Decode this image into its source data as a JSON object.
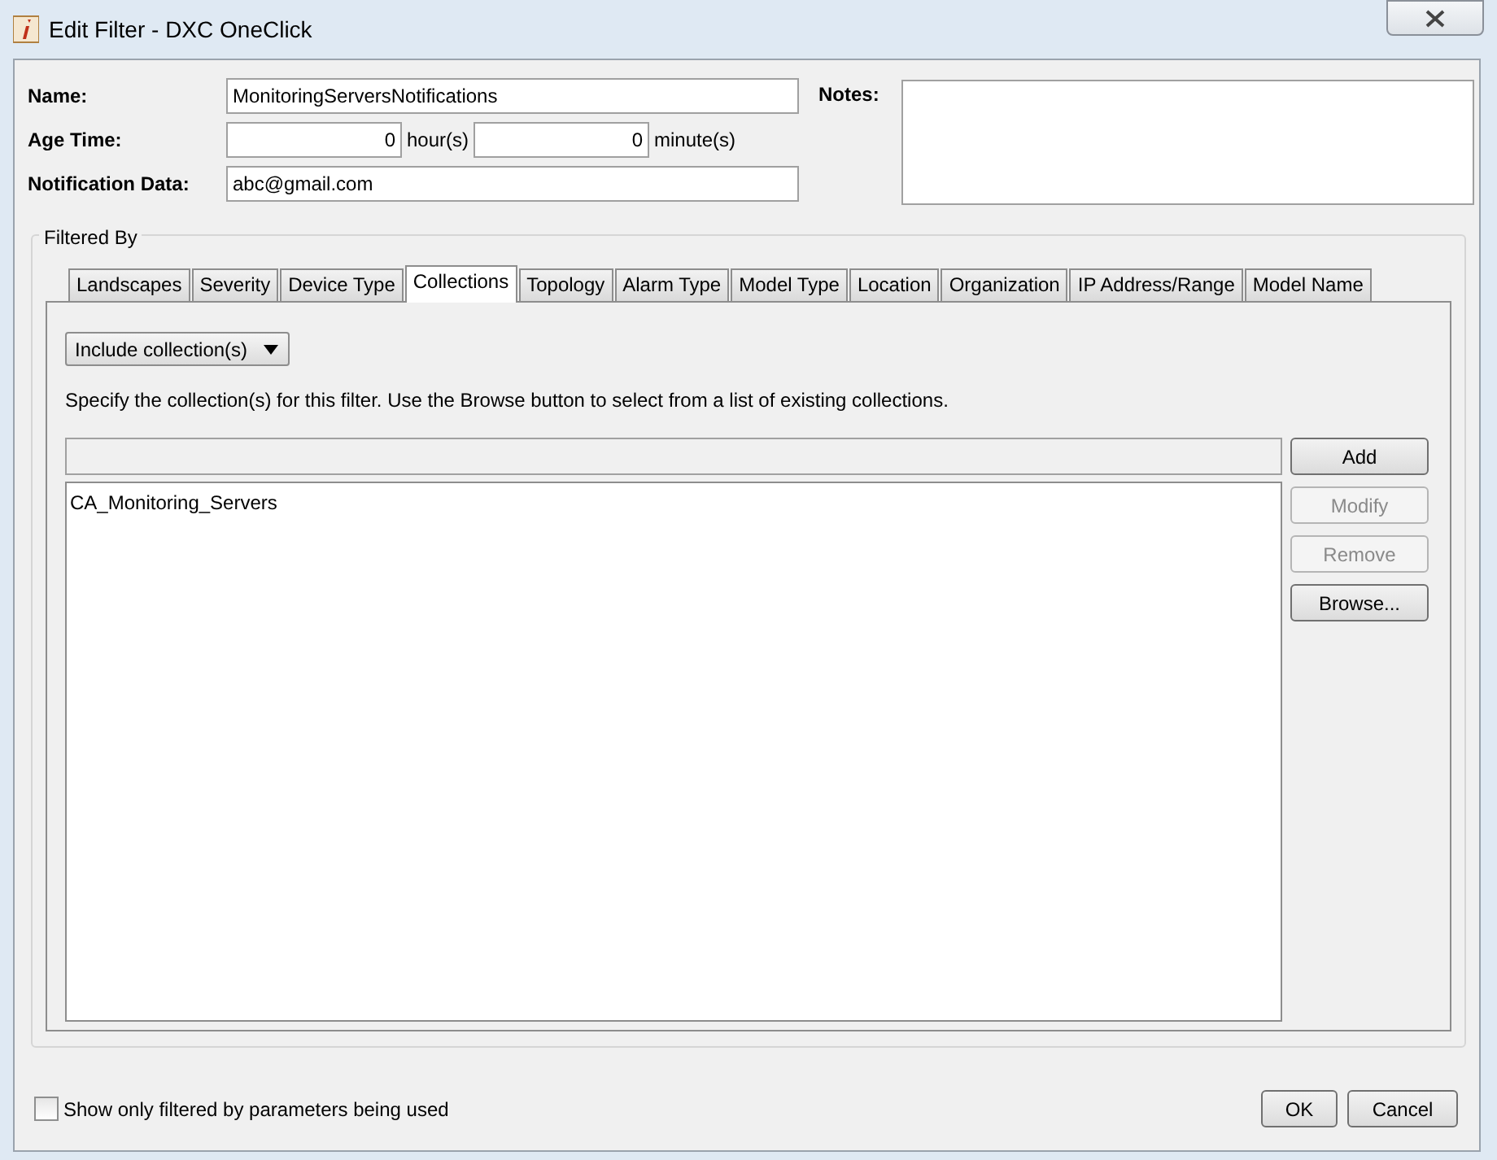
{
  "window": {
    "title": "Edit Filter - DXC OneClick"
  },
  "fields": {
    "name": {
      "label": "Name:",
      "value": "MonitoringServersNotifications"
    },
    "age_time": {
      "label": "Age Time:",
      "hours": "0",
      "hours_unit": "hour(s)",
      "minutes": "0",
      "minutes_unit": "minute(s)"
    },
    "notification_data": {
      "label": "Notification Data:",
      "value": "abc@gmail.com"
    },
    "notes": {
      "label": "Notes:"
    }
  },
  "filtered_by": {
    "title": "Filtered By",
    "tabs": [
      {
        "label": "Landscapes",
        "selected": false
      },
      {
        "label": "Severity",
        "selected": false
      },
      {
        "label": "Device Type",
        "selected": false
      },
      {
        "label": "Collections",
        "selected": true
      },
      {
        "label": "Topology",
        "selected": false
      },
      {
        "label": "Alarm Type",
        "selected": false
      },
      {
        "label": "Model Type",
        "selected": false
      },
      {
        "label": "Location",
        "selected": false
      },
      {
        "label": "Organization",
        "selected": false
      },
      {
        "label": "IP Address/Range",
        "selected": false
      },
      {
        "label": "Model Name",
        "selected": false
      }
    ],
    "mode_dropdown": "Include collection(s)",
    "description": "Specify the collection(s) for this filter. Use the Browse button to select from a list of existing collections.",
    "collections": [
      "CA_Monitoring_Servers"
    ],
    "buttons": [
      {
        "label": "Add",
        "disabled": false
      },
      {
        "label": "Modify",
        "disabled": true
      },
      {
        "label": "Remove",
        "disabled": true
      },
      {
        "label": "Browse...",
        "disabled": false
      }
    ]
  },
  "show_only_used": {
    "label": "Show only filtered by parameters being used",
    "checked": false
  },
  "buttons": [
    "OK",
    "Cancel"
  ]
}
